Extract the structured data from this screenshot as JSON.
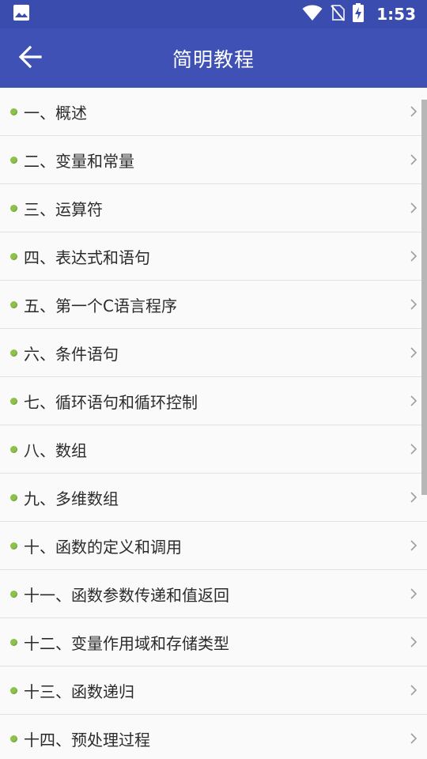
{
  "status_bar": {
    "time": "1:53",
    "icons": [
      "image-icon",
      "wifi-icon",
      "no-sim-icon",
      "battery-charging-icon"
    ]
  },
  "app_bar": {
    "title": "简明教程",
    "back_icon": "arrow-left-icon"
  },
  "colors": {
    "app_bar": "#3f51b5",
    "status_bar": "#3a4cae",
    "bullet": "#8bc34a",
    "background": "#fafafa"
  },
  "list": {
    "items": [
      {
        "label": "一、概述"
      },
      {
        "label": "二、变量和常量"
      },
      {
        "label": "三、运算符"
      },
      {
        "label": "四、表达式和语句"
      },
      {
        "label": "五、第一个C语言程序"
      },
      {
        "label": "六、条件语句"
      },
      {
        "label": "七、循环语句和循环控制"
      },
      {
        "label": "八、数组"
      },
      {
        "label": "九、多维数组"
      },
      {
        "label": "十、函数的定义和调用"
      },
      {
        "label": "十一、函数参数传递和值返回"
      },
      {
        "label": "十二、变量作用域和存储类型"
      },
      {
        "label": "十三、函数递归"
      },
      {
        "label": "十四、预处理过程"
      }
    ]
  }
}
